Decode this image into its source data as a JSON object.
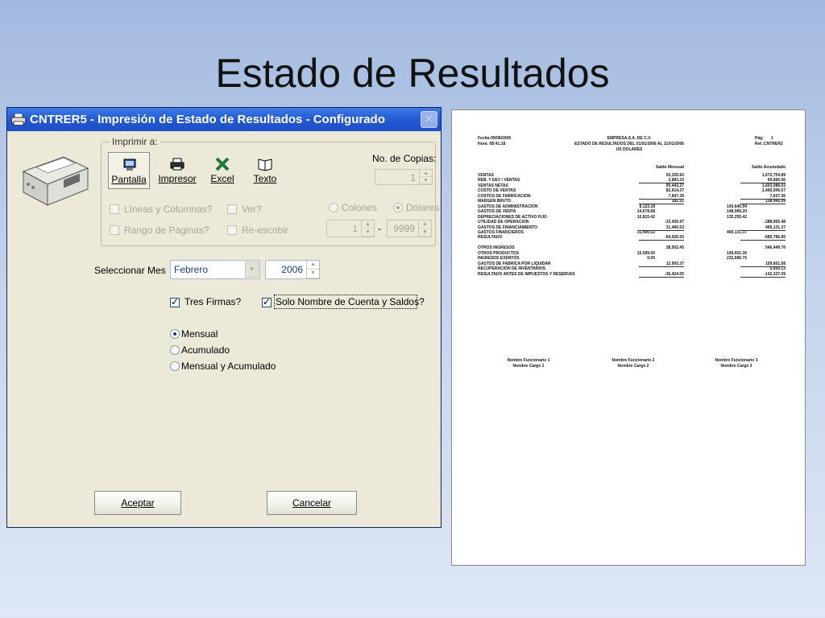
{
  "slide": {
    "title": "Estado de Resultados"
  },
  "window": {
    "title": "CNTRER5 - Impresión de Estado de Resultados - Configurado",
    "group_label": "Imprimir a:",
    "targets": [
      {
        "label": "Pantalla",
        "icon": "monitor-icon",
        "selected": true
      },
      {
        "label": "Impresor",
        "icon": "printer-icon",
        "selected": false
      },
      {
        "label": "Excel",
        "icon": "excel-icon",
        "selected": false
      },
      {
        "label": "Texto",
        "icon": "book-icon",
        "selected": false
      }
    ],
    "copies": {
      "label": "No. de Copias:",
      "value": "1"
    },
    "options": {
      "lineas_columnas": "Líneas y Columnas?",
      "ver": "Ver?",
      "rango_paginas": "Rango de Páginas?",
      "reescribir": "Re-escribir",
      "colones": "Colones",
      "dolares": "Dólares",
      "page_from": "1",
      "page_to": "9999",
      "range_separator": "-"
    },
    "month": {
      "label": "Seleccionar Mes",
      "value": "Febrero",
      "year": "2006"
    },
    "checks": {
      "tres_firmas": "Tres Firmas?",
      "solo_nombre": "Solo Nombre de Cuenta y Saldos?"
    },
    "periods": [
      "Mensual",
      "Acumulado",
      "Mensual y Acumulado"
    ],
    "buttons": {
      "accept": "Aceptar",
      "cancel": "Cancelar"
    }
  },
  "report": {
    "date": "Fecha:09/08/2006",
    "time": "Hora: 08:41:18",
    "company": "EMPRESA,S.A. DE C.V.",
    "heading": "ESTADO DE RESULTADOS DEL 01/01/2006 AL 31/01/2006",
    "currency": "US DOLARES",
    "page": "Pág:",
    "page_no": "1",
    "ref": "Ref.:CNTRER2",
    "col_month": "Saldo Mensual",
    "col_acc": "Saldo Acumulado",
    "rows": [
      {
        "label": "VENTAS",
        "a": "",
        "b": "93,326.60",
        "c": "",
        "d": "1,672,754.89"
      },
      {
        "label": "REB. Y DEV / VENTAS",
        "a": "",
        "b": "2,883.33",
        "c": "",
        "d": "69,666.96"
      },
      {
        "label": "VENTAS NETAS",
        "a": "",
        "b": "90,443.27",
        "c": "",
        "d": "1,603,088.03"
      },
      {
        "label": "COSTO DE VENTAS",
        "a": "",
        "b": "82,614.37",
        "c": "",
        "d": "1,456,506.57"
      },
      {
        "label": "COSTOS DE FABRICACION",
        "a": "",
        "b": "7,847.39",
        "c": "",
        "d": "7,637.36"
      },
      {
        "label": "MARGEN BRUTO",
        "a": "",
        "b": "181.51",
        "c": "",
        "d": "138,945.09"
      },
      {
        "label": "GASTOS DE ADMINISTRACION",
        "a": "8,123.18",
        "b": "",
        "c": "143,645.94",
        "d": ""
      },
      {
        "label": "GASTOS DE VENTA",
        "a": "14,678.68",
        "b": "",
        "c": "148,999.20",
        "d": ""
      },
      {
        "label": "DEPRECIACIONES DE ACTIVO FIJO",
        "a": "10,815.42",
        "b": "",
        "c": "135,255.42",
        "d": ""
      },
      {
        "label": "UTILIDAD DE OPERACION",
        "a": "",
        "b": "-33,435.97",
        "c": "",
        "d": "-288,955.48"
      },
      {
        "label": "GASTOS DE FINANCIAMIENTO",
        "a": "",
        "b": "31,490.53",
        "c": "",
        "d": "400,131.37"
      },
      {
        "label": "GASTOS FINANCIEROS",
        "a": "31,490.53",
        "b": "",
        "c": "400,131.37",
        "d": ""
      },
      {
        "label": "RESULTADO",
        "a": "",
        "b": "-64,926.50",
        "c": "",
        "d": "-689,786.85"
      },
      {
        "label": "",
        "a": "",
        "b": "",
        "c": "",
        "d": ""
      },
      {
        "label": "OTROS INGRESOS",
        "a": "",
        "b": "28,502.45",
        "c": "",
        "d": "546,449.76"
      },
      {
        "label": "OTROS PRODUCTOS",
        "a": "15,599.00",
        "b": "",
        "c": "149,601.36",
        "d": ""
      },
      {
        "label": "INGRESOS EXENTOS",
        "a": "0.00",
        "b": "",
        "c": "232,696.75",
        "d": ""
      },
      {
        "label": "GASTOS DE FABRICA POR LIQUIDAR",
        "a": "",
        "b": "12,903.37",
        "c": "",
        "d": "159,601.58"
      },
      {
        "label": "RECUPERACION DE INVENTARIOS",
        "a": "",
        "b": "",
        "c": "",
        "d": "5,650.13"
      },
      {
        "label": "RESULTADO ANTES DE IMPUESTOS Y RESERVAS",
        "a": "",
        "b": "-36,424.05",
        "c": "",
        "d": "-142,337.09"
      }
    ],
    "signatures": [
      {
        "name": "Nombre Funcionario 1",
        "role": "Nombre Cargo 1"
      },
      {
        "name": "Nombre Funcionario 2",
        "role": "Nombre Cargo 2"
      },
      {
        "name": "Nombre Funcionario 3",
        "role": "Nombre Cargo 3"
      }
    ]
  },
  "colors": {
    "titlebar": "#2459d1",
    "window_bg": "#ece9d8",
    "accent_text": "#1a3d8c"
  }
}
